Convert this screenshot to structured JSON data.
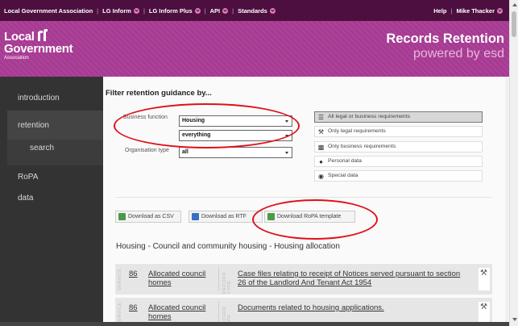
{
  "topnav": {
    "items": [
      {
        "label": "Local Government Association",
        "chevron": false
      },
      {
        "label": "LG Inform",
        "chevron": true
      },
      {
        "label": "LG Inform Plus",
        "chevron": true
      },
      {
        "label": "API",
        "chevron": true
      },
      {
        "label": "Standards",
        "chevron": true
      }
    ],
    "help": "Help",
    "user": "Mike Thacker",
    "user_chevron": true
  },
  "header": {
    "logo_line1": "Local",
    "logo_line2": "Government",
    "logo_line3": "Association",
    "title": "Records Retention",
    "subtitle": "powered by esd"
  },
  "sidebar": {
    "items": [
      "introduction",
      "retention",
      "search",
      "RoPA",
      "data"
    ],
    "active": "retention"
  },
  "filter": {
    "heading": "Filter retention guidance by...",
    "business_function_label": "Business function",
    "business_function_value": "Housing",
    "sub_function_value": "everything",
    "organisation_type_label": "Organisation type",
    "organisation_type_value": "all",
    "options": [
      {
        "label": "All legal or business requirements",
        "icon": "list-icon",
        "selected": true
      },
      {
        "label": "Only legal requirements",
        "icon": "gavel-icon",
        "selected": false
      },
      {
        "label": "Only business requirements",
        "icon": "briefcase-icon",
        "selected": false
      },
      {
        "label": "Personal data",
        "icon": "person-icon",
        "selected": false
      },
      {
        "label": "Special data",
        "icon": "special-icon",
        "selected": false
      }
    ]
  },
  "downloads": {
    "csv": "Download as CSV",
    "rtf": "Download as RTF",
    "ropa": "Download RoPA template"
  },
  "section_title": "Housing - Council and community housing - Housing allocation",
  "records": [
    {
      "service_label": "SERVICE",
      "number": "86",
      "service": "Allocated council homes",
      "record_type_label": "RECORD TYPE",
      "record": "Case files relating to receipt of Notices served pursuant to section 26 of the Landlord And Tenant Act 1954"
    },
    {
      "service_label": "SERVICE",
      "number": "86",
      "service": "Allocated council homes",
      "record_type_label": "RECORD TYPE",
      "record": "Documents related to housing applications."
    }
  ],
  "colors": {
    "nav_bg": "#4d0f3f",
    "header_bg": "#a73a92",
    "sidebar_bg": "#333333",
    "annotation": "#e0101a"
  }
}
